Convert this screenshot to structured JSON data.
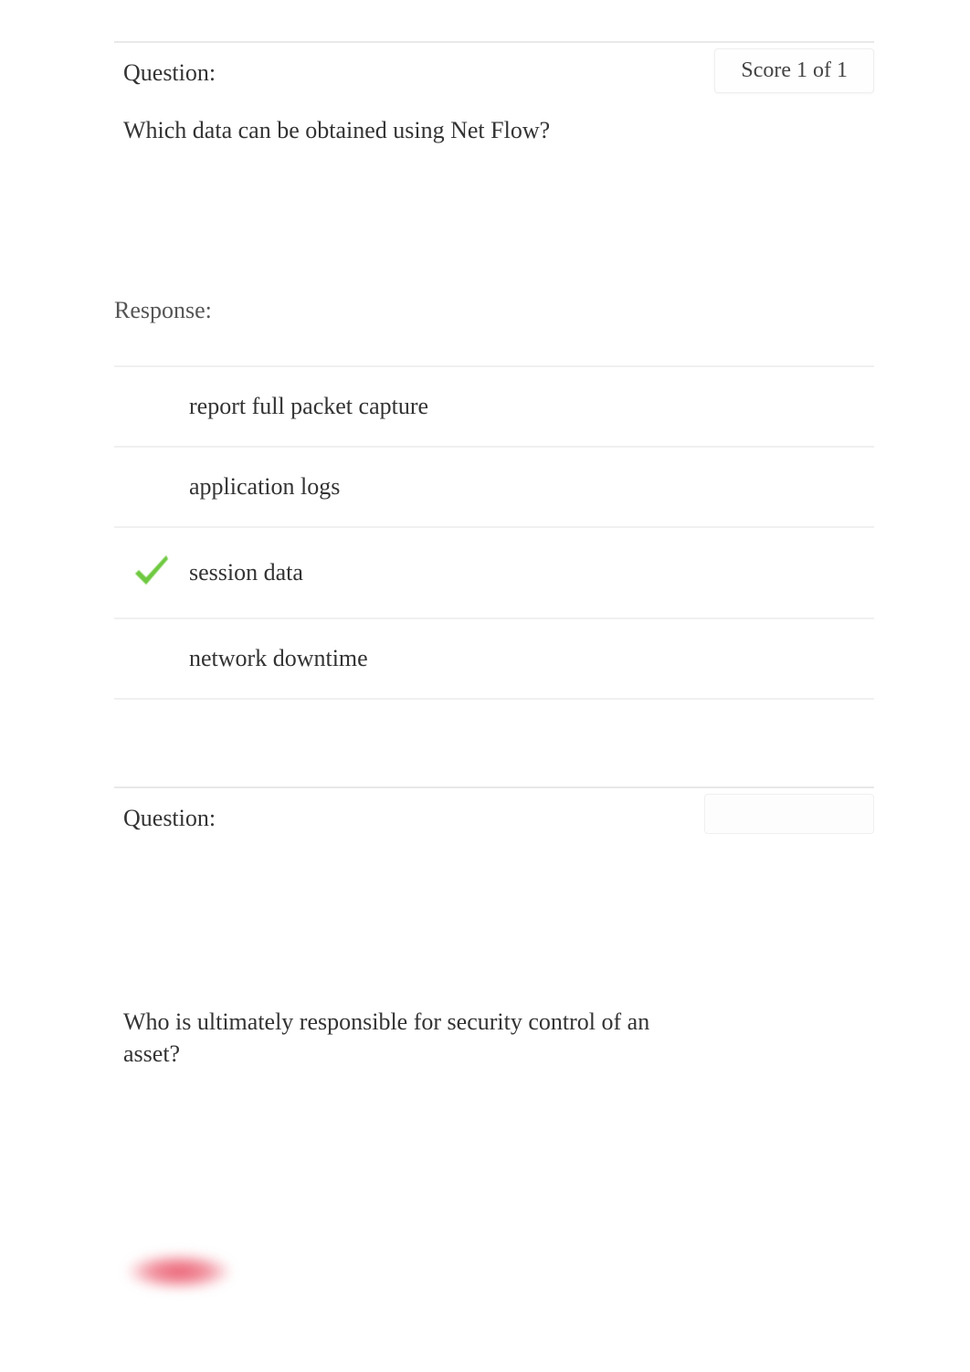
{
  "q1": {
    "label": "Question:",
    "text": "Which data can be obtained using Net Flow?",
    "score": "Score 1 of 1",
    "response_label": "Response:",
    "answers": [
      {
        "text": "report full packet capture",
        "correct": false
      },
      {
        "text": "application logs",
        "correct": false
      },
      {
        "text": "session data",
        "correct": true
      },
      {
        "text": "network downtime",
        "correct": false
      }
    ]
  },
  "q2": {
    "label": "Question:",
    "text": "Who is ultimately responsible for security control of an asset?"
  }
}
